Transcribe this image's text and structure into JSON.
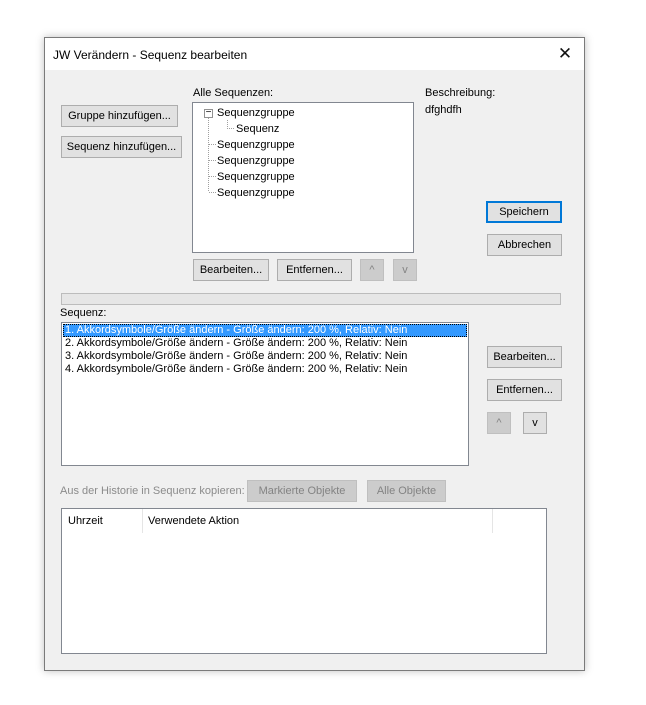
{
  "window": {
    "title": "JW Verändern - Sequenz bearbeiten",
    "close_glyph": "✕"
  },
  "left_buttons": {
    "add_group": "Gruppe hinzufügen...",
    "add_sequence": "Sequenz hinzufügen..."
  },
  "all_sequences": {
    "label": "Alle Sequenzen:",
    "tree": [
      {
        "label": "Sequenzgruppe",
        "level": 0,
        "expanded": true
      },
      {
        "label": "Sequenz",
        "level": 1
      },
      {
        "label": "Sequenzgruppe",
        "level": 0
      },
      {
        "label": "Sequenzgruppe",
        "level": 0
      },
      {
        "label": "Sequenzgruppe",
        "level": 0
      },
      {
        "label": "Sequenzgruppe",
        "level": 0
      }
    ],
    "expander_glyph": "−",
    "edit_button": "Bearbeiten...",
    "remove_button": "Entfernen...",
    "up_glyph": "^",
    "down_glyph": "v"
  },
  "description": {
    "label": "Beschreibung:",
    "value": "dfghdfh"
  },
  "actions": {
    "save": "Speichern",
    "cancel": "Abbrechen"
  },
  "sequence": {
    "label": "Sequenz:",
    "items": [
      {
        "text": "1. Akkordsymbole/Größe ändern - Größe ändern: 200 %, Relativ: Nein",
        "selected": true
      },
      {
        "text": "2. Akkordsymbole/Größe ändern - Größe ändern: 200 %, Relativ: Nein",
        "selected": false
      },
      {
        "text": "3. Akkordsymbole/Größe ändern - Größe ändern: 200 %, Relativ: Nein",
        "selected": false
      },
      {
        "text": "4. Akkordsymbole/Größe ändern - Größe ändern: 200 %, Relativ: Nein",
        "selected": false
      }
    ],
    "edit_button": "Bearbeiten...",
    "remove_button": "Entfernen...",
    "up_glyph": "^",
    "down_glyph": "v"
  },
  "history": {
    "label": "Aus der Historie in Sequenz kopieren:",
    "marked_button": "Markierte Objekte",
    "all_button": "Alle Objekte",
    "columns": [
      "Uhrzeit",
      "Verwendete Aktion"
    ],
    "rows": []
  },
  "colors": {
    "selection": "#3399ff",
    "default_button_border": "#0078d7",
    "dialog_bg": "#f0f0f0"
  }
}
